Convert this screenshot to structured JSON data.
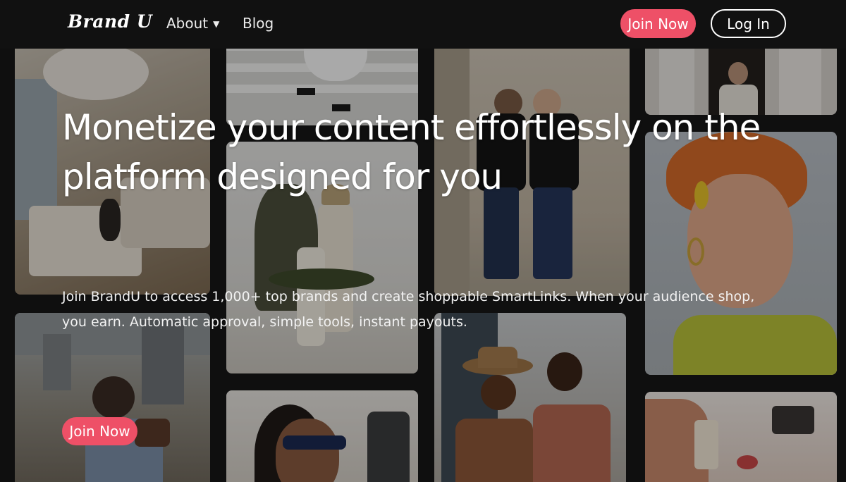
{
  "nav": {
    "logo": "Brand U",
    "about_label": "About",
    "about_caret": "▼",
    "blog_label": "Blog",
    "join_label": "Join Now",
    "login_label": "Log In"
  },
  "hero": {
    "title": "Monetize your content effortlessly on the platform designed for you",
    "subtitle": "Join BrandU to access 1,000+ top brands and create shoppable SmartLinks. When your audience shop, you earn. Automatic approval, simple tools, instant payouts.",
    "cta_label": "Join Now"
  },
  "colors": {
    "accent": "#ee5067",
    "nav_bg": "#111111",
    "page_bg": "#101010"
  },
  "background_photos": [
    "living-room-photo",
    "crosswalk-legs-photo",
    "two-men-suits-photo",
    "woman-doorway-photo",
    "mother-daughter-photo",
    "redhead-makeup-photo",
    "city-woman-handbag-photo",
    "selfie-sunglasses-photo",
    "couple-hat-photo",
    "perfume-bottles-photo"
  ]
}
